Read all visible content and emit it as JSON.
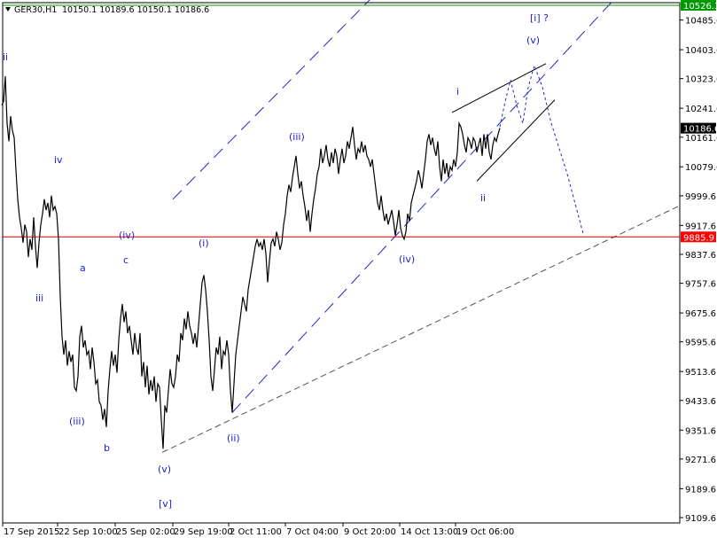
{
  "header": {
    "symbol": "GER30,H1",
    "ohlc": "10150.1 10189.6 10150.1 10186.6"
  },
  "chart_data": {
    "type": "line",
    "title": "",
    "xlabel": "",
    "ylabel": "",
    "ylim": [
      9109.6,
      10526.3
    ],
    "grid": false,
    "y_ticks": [
      "10485.6",
      "10403.6",
      "10323.6",
      "10241.6",
      "10161.6",
      "10079.6",
      "9999.6",
      "9917.6",
      "9837.6",
      "9757.6",
      "9675.6",
      "9595.6",
      "9513.6",
      "9433.6",
      "9351.6",
      "9271.6",
      "9189.6",
      "9109.6"
    ],
    "x_ticks": [
      "17 Sep 2015",
      "22 Sep 10:00",
      "25 Sep 02:00",
      "29 Sep 19:00",
      "2 Oct 11:00",
      "7 Oct 04:00",
      "9 Oct 20:00",
      "14 Oct 13:00",
      "19 Oct 06:00"
    ],
    "price_labels": [
      {
        "value": 10526.3,
        "text": "10526.3",
        "color": "#009900"
      },
      {
        "value": 10186.6,
        "text": "10186.6",
        "color": "#000000"
      },
      {
        "value": 9885.9,
        "text": "9885.9",
        "color": "#ff0000"
      }
    ],
    "horizontal_lines": [
      {
        "value": 10526.3,
        "color": "#009900"
      },
      {
        "value": 9885.9,
        "color": "#cc0000"
      }
    ],
    "wave_labels": [
      "ii",
      "iv",
      "iii",
      "a",
      "(iv)",
      "c",
      "(iii)",
      "b",
      "(v)",
      "[v]",
      "(i)",
      "(ii)",
      "(iii)",
      "(iv)",
      "i",
      "ii",
      "(v)",
      "[i] ?"
    ],
    "price_points": [
      [
        2,
        10250
      ],
      [
        4,
        10260
      ],
      [
        6,
        10330
      ],
      [
        8,
        10200
      ],
      [
        10,
        10150
      ],
      [
        12,
        10220
      ],
      [
        14,
        10180
      ],
      [
        16,
        10160
      ],
      [
        18,
        10070
      ],
      [
        20,
        9990
      ],
      [
        22,
        9940
      ],
      [
        24,
        9910
      ],
      [
        26,
        9870
      ],
      [
        28,
        9920
      ],
      [
        30,
        9900
      ],
      [
        32,
        9830
      ],
      [
        34,
        9880
      ],
      [
        36,
        9850
      ],
      [
        38,
        9940
      ],
      [
        40,
        9860
      ],
      [
        42,
        9800
      ],
      [
        44,
        9870
      ],
      [
        46,
        9920
      ],
      [
        48,
        9950
      ],
      [
        50,
        9990
      ],
      [
        52,
        9960
      ],
      [
        54,
        9980
      ],
      [
        56,
        9940
      ],
      [
        58,
        10000
      ],
      [
        60,
        9960
      ],
      [
        62,
        9970
      ],
      [
        64,
        9950
      ],
      [
        66,
        9880
      ],
      [
        68,
        9720
      ],
      [
        70,
        9610
      ],
      [
        72,
        9560
      ],
      [
        74,
        9600
      ],
      [
        76,
        9530
      ],
      [
        78,
        9570
      ],
      [
        80,
        9540
      ],
      [
        82,
        9560
      ],
      [
        84,
        9470
      ],
      [
        86,
        9460
      ],
      [
        88,
        9500
      ],
      [
        90,
        9610
      ],
      [
        92,
        9640
      ],
      [
        94,
        9580
      ],
      [
        96,
        9600
      ],
      [
        98,
        9560
      ],
      [
        100,
        9570
      ],
      [
        102,
        9520
      ],
      [
        104,
        9580
      ],
      [
        106,
        9540
      ],
      [
        108,
        9480
      ],
      [
        110,
        9490
      ],
      [
        112,
        9430
      ],
      [
        114,
        9420
      ],
      [
        116,
        9380
      ],
      [
        118,
        9410
      ],
      [
        120,
        9360
      ],
      [
        122,
        9460
      ],
      [
        124,
        9520
      ],
      [
        126,
        9570
      ],
      [
        128,
        9530
      ],
      [
        130,
        9560
      ],
      [
        132,
        9510
      ],
      [
        134,
        9600
      ],
      [
        136,
        9660
      ],
      [
        138,
        9700
      ],
      [
        140,
        9650
      ],
      [
        142,
        9680
      ],
      [
        144,
        9620
      ],
      [
        146,
        9640
      ],
      [
        148,
        9600
      ],
      [
        150,
        9560
      ],
      [
        152,
        9620
      ],
      [
        154,
        9580
      ],
      [
        156,
        9560
      ],
      [
        158,
        9620
      ],
      [
        160,
        9500
      ],
      [
        162,
        9540
      ],
      [
        164,
        9470
      ],
      [
        166,
        9530
      ],
      [
        168,
        9450
      ],
      [
        170,
        9490
      ],
      [
        172,
        9460
      ],
      [
        174,
        9500
      ],
      [
        176,
        9430
      ],
      [
        178,
        9480
      ],
      [
        180,
        9470
      ],
      [
        182,
        9380
      ],
      [
        184,
        9300
      ],
      [
        186,
        9420
      ],
      [
        188,
        9400
      ],
      [
        190,
        9460
      ],
      [
        192,
        9520
      ],
      [
        194,
        9480
      ],
      [
        196,
        9470
      ],
      [
        198,
        9500
      ],
      [
        200,
        9560
      ],
      [
        202,
        9540
      ],
      [
        204,
        9620
      ],
      [
        206,
        9600
      ],
      [
        208,
        9660
      ],
      [
        210,
        9630
      ],
      [
        212,
        9680
      ],
      [
        214,
        9640
      ],
      [
        216,
        9620
      ],
      [
        218,
        9590
      ],
      [
        220,
        9620
      ],
      [
        222,
        9580
      ],
      [
        224,
        9640
      ],
      [
        226,
        9700
      ],
      [
        228,
        9760
      ],
      [
        230,
        9780
      ],
      [
        232,
        9740
      ],
      [
        234,
        9680
      ],
      [
        236,
        9600
      ],
      [
        238,
        9500
      ],
      [
        240,
        9460
      ],
      [
        242,
        9520
      ],
      [
        244,
        9580
      ],
      [
        246,
        9560
      ],
      [
        248,
        9610
      ],
      [
        250,
        9520
      ],
      [
        252,
        9570
      ],
      [
        254,
        9560
      ],
      [
        256,
        9600
      ],
      [
        258,
        9560
      ],
      [
        260,
        9460
      ],
      [
        262,
        9400
      ],
      [
        264,
        9480
      ],
      [
        266,
        9560
      ],
      [
        268,
        9600
      ],
      [
        270,
        9640
      ],
      [
        272,
        9680
      ],
      [
        274,
        9720
      ],
      [
        276,
        9700
      ],
      [
        278,
        9680
      ],
      [
        280,
        9740
      ],
      [
        282,
        9770
      ],
      [
        284,
        9800
      ],
      [
        286,
        9830
      ],
      [
        288,
        9860
      ],
      [
        290,
        9880
      ],
      [
        292,
        9860
      ],
      [
        294,
        9870
      ],
      [
        296,
        9850
      ],
      [
        298,
        9880
      ],
      [
        300,
        9840
      ],
      [
        302,
        9760
      ],
      [
        304,
        9820
      ],
      [
        306,
        9870
      ],
      [
        308,
        9880
      ],
      [
        310,
        9860
      ],
      [
        312,
        9900
      ],
      [
        314,
        9880
      ],
      [
        316,
        9850
      ],
      [
        318,
        9870
      ],
      [
        320,
        9920
      ],
      [
        322,
        9950
      ],
      [
        324,
        10000
      ],
      [
        326,
        10030
      ],
      [
        328,
        10010
      ],
      [
        330,
        10050
      ],
      [
        332,
        10080
      ],
      [
        334,
        10110
      ],
      [
        336,
        10060
      ],
      [
        338,
        10020
      ],
      [
        340,
        10040
      ],
      [
        342,
        10000
      ],
      [
        344,
        9970
      ],
      [
        346,
        9930
      ],
      [
        348,
        9960
      ],
      [
        350,
        9900
      ],
      [
        352,
        9950
      ],
      [
        354,
        9990
      ],
      [
        356,
        10020
      ],
      [
        358,
        10060
      ],
      [
        360,
        10080
      ],
      [
        362,
        10130
      ],
      [
        364,
        10090
      ],
      [
        366,
        10110
      ],
      [
        368,
        10140
      ],
      [
        370,
        10100
      ],
      [
        372,
        10080
      ],
      [
        374,
        10120
      ],
      [
        376,
        10090
      ],
      [
        378,
        10130
      ],
      [
        380,
        10110
      ],
      [
        382,
        10060
      ],
      [
        384,
        10100
      ],
      [
        386,
        10130
      ],
      [
        388,
        10090
      ],
      [
        390,
        10110
      ],
      [
        392,
        10150
      ],
      [
        394,
        10130
      ],
      [
        396,
        10160
      ],
      [
        398,
        10190
      ],
      [
        400,
        10140
      ],
      [
        402,
        10100
      ],
      [
        404,
        10130
      ],
      [
        406,
        10120
      ],
      [
        408,
        10150
      ],
      [
        410,
        10120
      ],
      [
        412,
        10140
      ],
      [
        414,
        10110
      ],
      [
        416,
        10100
      ],
      [
        418,
        10080
      ],
      [
        420,
        10100
      ],
      [
        422,
        10060
      ],
      [
        424,
        10020
      ],
      [
        426,
        9980
      ],
      [
        428,
        9960
      ],
      [
        430,
        10000
      ],
      [
        432,
        9960
      ],
      [
        434,
        9930
      ],
      [
        436,
        9950
      ],
      [
        438,
        9920
      ],
      [
        440,
        9940
      ],
      [
        442,
        9960
      ],
      [
        444,
        9930
      ],
      [
        446,
        9890
      ],
      [
        448,
        9920
      ],
      [
        450,
        9960
      ],
      [
        452,
        9910
      ],
      [
        454,
        9890
      ],
      [
        456,
        9880
      ],
      [
        458,
        9900
      ],
      [
        460,
        9950
      ],
      [
        462,
        9930
      ],
      [
        464,
        9980
      ],
      [
        466,
        10000
      ],
      [
        468,
        10020
      ],
      [
        470,
        10040
      ],
      [
        472,
        10070
      ],
      [
        474,
        10050
      ],
      [
        476,
        10020
      ],
      [
        478,
        10060
      ],
      [
        480,
        10100
      ],
      [
        482,
        10150
      ],
      [
        484,
        10170
      ],
      [
        486,
        10140
      ],
      [
        488,
        10160
      ],
      [
        490,
        10130
      ],
      [
        492,
        10110
      ],
      [
        494,
        10150
      ],
      [
        496,
        10080
      ],
      [
        498,
        10040
      ],
      [
        500,
        10100
      ],
      [
        502,
        10060
      ],
      [
        504,
        10090
      ],
      [
        506,
        10050
      ],
      [
        508,
        10080
      ],
      [
        510,
        10070
      ],
      [
        512,
        10100
      ],
      [
        514,
        10080
      ],
      [
        516,
        10120
      ],
      [
        518,
        10200
      ],
      [
        520,
        10190
      ],
      [
        522,
        10170
      ],
      [
        524,
        10140
      ],
      [
        526,
        10120
      ],
      [
        528,
        10160
      ],
      [
        530,
        10150
      ],
      [
        532,
        10130
      ],
      [
        534,
        10160
      ],
      [
        536,
        10150
      ],
      [
        538,
        10120
      ],
      [
        540,
        10140
      ],
      [
        542,
        10160
      ],
      [
        544,
        10110
      ],
      [
        546,
        10170
      ],
      [
        548,
        10130
      ],
      [
        550,
        10170
      ],
      [
        552,
        10120
      ],
      [
        554,
        10100
      ],
      [
        556,
        10140
      ],
      [
        558,
        10160
      ],
      [
        560,
        10150
      ],
      [
        562,
        10170
      ],
      [
        564,
        10186.6
      ]
    ],
    "overlay_lines": [
      {
        "style": "dash-long",
        "color": "#2424c8",
        "points": [
          [
            195,
            9990
          ],
          [
            493,
            10730
          ]
        ]
      },
      {
        "style": "dash-long",
        "color": "#2424c8",
        "points": [
          [
            262,
            9400
          ],
          [
            690,
            10535
          ]
        ]
      },
      {
        "style": "dash",
        "color": "#555555",
        "points": [
          [
            183,
            9290
          ],
          [
            765,
            9970
          ]
        ]
      },
      {
        "style": "solid",
        "color": "#000000",
        "points": [
          [
            510,
            10230
          ],
          [
            616,
            10365
          ]
        ]
      },
      {
        "style": "solid",
        "color": "#000000",
        "points": [
          [
            538,
            10040
          ],
          [
            626,
            10265
          ]
        ]
      },
      {
        "style": "dot",
        "color": "#2424c8",
        "points": [
          [
            564,
            10190
          ],
          [
            570,
            10260
          ],
          [
            576,
            10320
          ],
          [
            583,
            10250
          ],
          [
            590,
            10200
          ],
          [
            596,
            10300
          ],
          [
            603,
            10360
          ],
          [
            612,
            10300
          ],
          [
            622,
            10200
          ],
          [
            640,
            10060
          ],
          [
            658,
            9895
          ]
        ]
      }
    ]
  }
}
